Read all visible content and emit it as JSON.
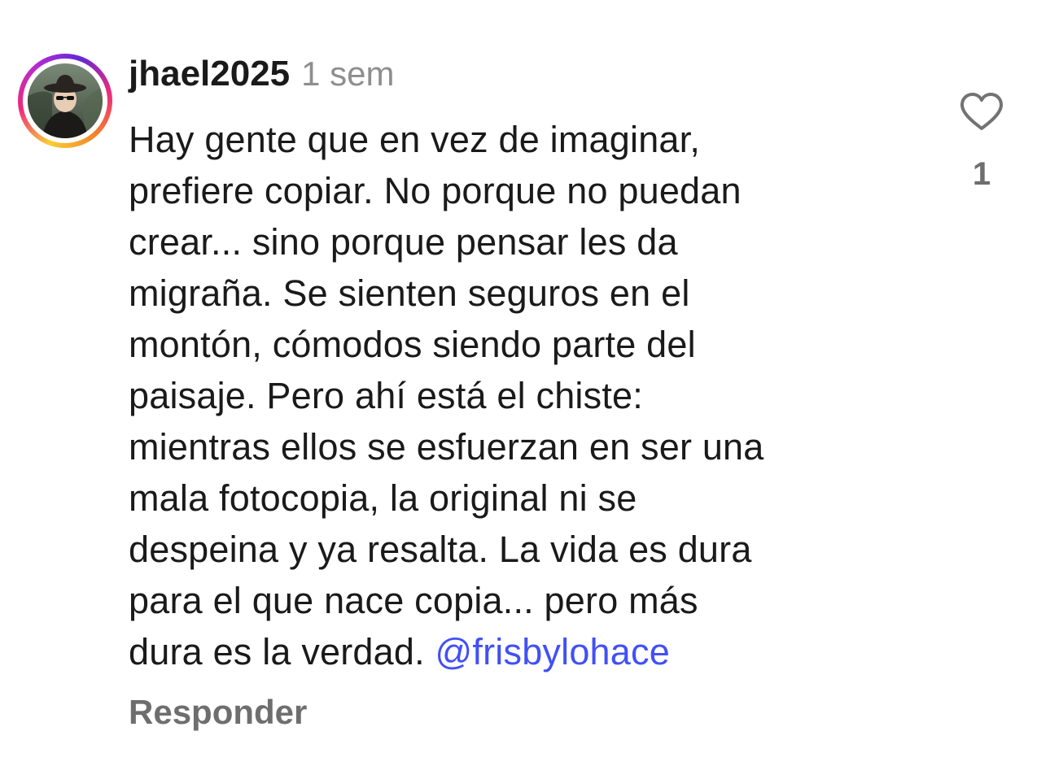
{
  "comment": {
    "username": "jhael2025",
    "timestamp": "1 sem",
    "avatar_icon": "avatar-icon",
    "body_lines": [
      "Hay gente que en vez de imaginar,",
      "prefiere copiar. No porque no puedan",
      "crear... sino porque pensar les da",
      "migraña. Se sienten seguros en el",
      "montón, cómodos siendo parte del",
      "paisaje. Pero ahí está el chiste:",
      "mientras ellos se esfuerzan en ser una",
      "mala fotocopia, la original ni se",
      "despeina y ya resalta. La vida es dura",
      "para el que nace copia... pero más"
    ],
    "last_line_text": "dura es la verdad. ",
    "mention": "@frisbylohace",
    "reply_label": "Responder",
    "like_icon": "heart-outline-icon",
    "like_count": "1"
  },
  "colors": {
    "text": "#1a1a1a",
    "muted": "#8e8e8e",
    "mention": "#4150f7",
    "secondary": "#6e6e6e"
  }
}
